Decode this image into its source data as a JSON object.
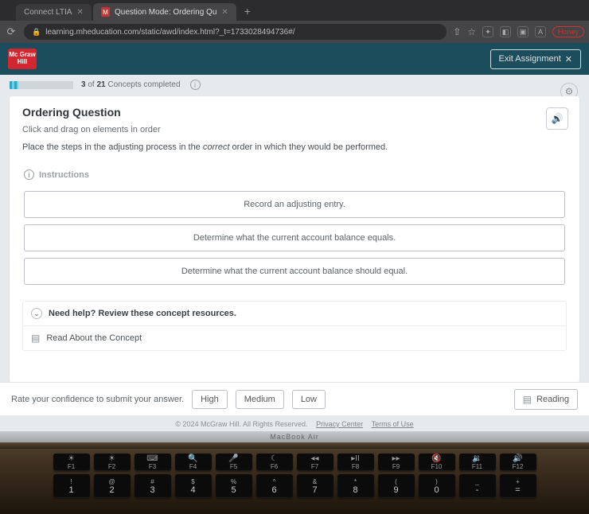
{
  "browser": {
    "tabs": [
      {
        "label": "Connect LTIA"
      },
      {
        "label": "Question Mode: Ordering Qu"
      }
    ],
    "url": "learning.mheducation.com/static/awd/index.html?_t=1733028494736#/"
  },
  "header": {
    "logo": "Mc Graw Hill",
    "exit": "Exit Assignment"
  },
  "progress": {
    "done": "3",
    "total": "21",
    "suffix": "Concepts completed"
  },
  "question": {
    "title": "Ordering Question",
    "subtitle": "Click and drag on elements in order",
    "prompt_pre": "Place the steps in the adjusting process in the ",
    "prompt_em": "correct",
    "prompt_post": " order in which they would be performed.",
    "instructions_label": "Instructions",
    "items": [
      "Record an adjusting entry.",
      "Determine what the current account balance equals.",
      "Determine what the current account balance should equal."
    ]
  },
  "help": {
    "heading": "Need help? Review these concept resources.",
    "read": "Read About the Concept"
  },
  "footer": {
    "confidence_label": "Rate your confidence to submit your answer.",
    "high": "High",
    "medium": "Medium",
    "low": "Low",
    "reading": "Reading",
    "copyright": "© 2024 McGraw Hill. All Rights Reserved.",
    "privacy": "Privacy Center",
    "terms": "Terms of Use"
  },
  "laptop": {
    "model": "MacBook Air",
    "frow": [
      {
        "sym": "☀",
        "lbl": "F1"
      },
      {
        "sym": "☀",
        "lbl": "F2"
      },
      {
        "sym": "⌨",
        "lbl": "F3"
      },
      {
        "sym": "🔍",
        "lbl": "F4"
      },
      {
        "sym": "🎤",
        "lbl": "F5"
      },
      {
        "sym": "☾",
        "lbl": "F6"
      },
      {
        "sym": "◂◂",
        "lbl": "F7"
      },
      {
        "sym": "▸II",
        "lbl": "F8"
      },
      {
        "sym": "▸▸",
        "lbl": "F9"
      },
      {
        "sym": "🔇",
        "lbl": "F10"
      },
      {
        "sym": "🔉",
        "lbl": "F11"
      },
      {
        "sym": "🔊",
        "lbl": "F12"
      }
    ],
    "nrow": [
      {
        "top": "!",
        "bot": "1"
      },
      {
        "top": "@",
        "bot": "2"
      },
      {
        "top": "#",
        "bot": "3"
      },
      {
        "top": "$",
        "bot": "4"
      },
      {
        "top": "%",
        "bot": "5"
      },
      {
        "top": "^",
        "bot": "6"
      },
      {
        "top": "&",
        "bot": "7"
      },
      {
        "top": "*",
        "bot": "8"
      },
      {
        "top": "(",
        "bot": "9"
      },
      {
        "top": ")",
        "bot": "0"
      },
      {
        "top": "_",
        "bot": "-"
      },
      {
        "top": "+",
        "bot": "="
      }
    ]
  }
}
